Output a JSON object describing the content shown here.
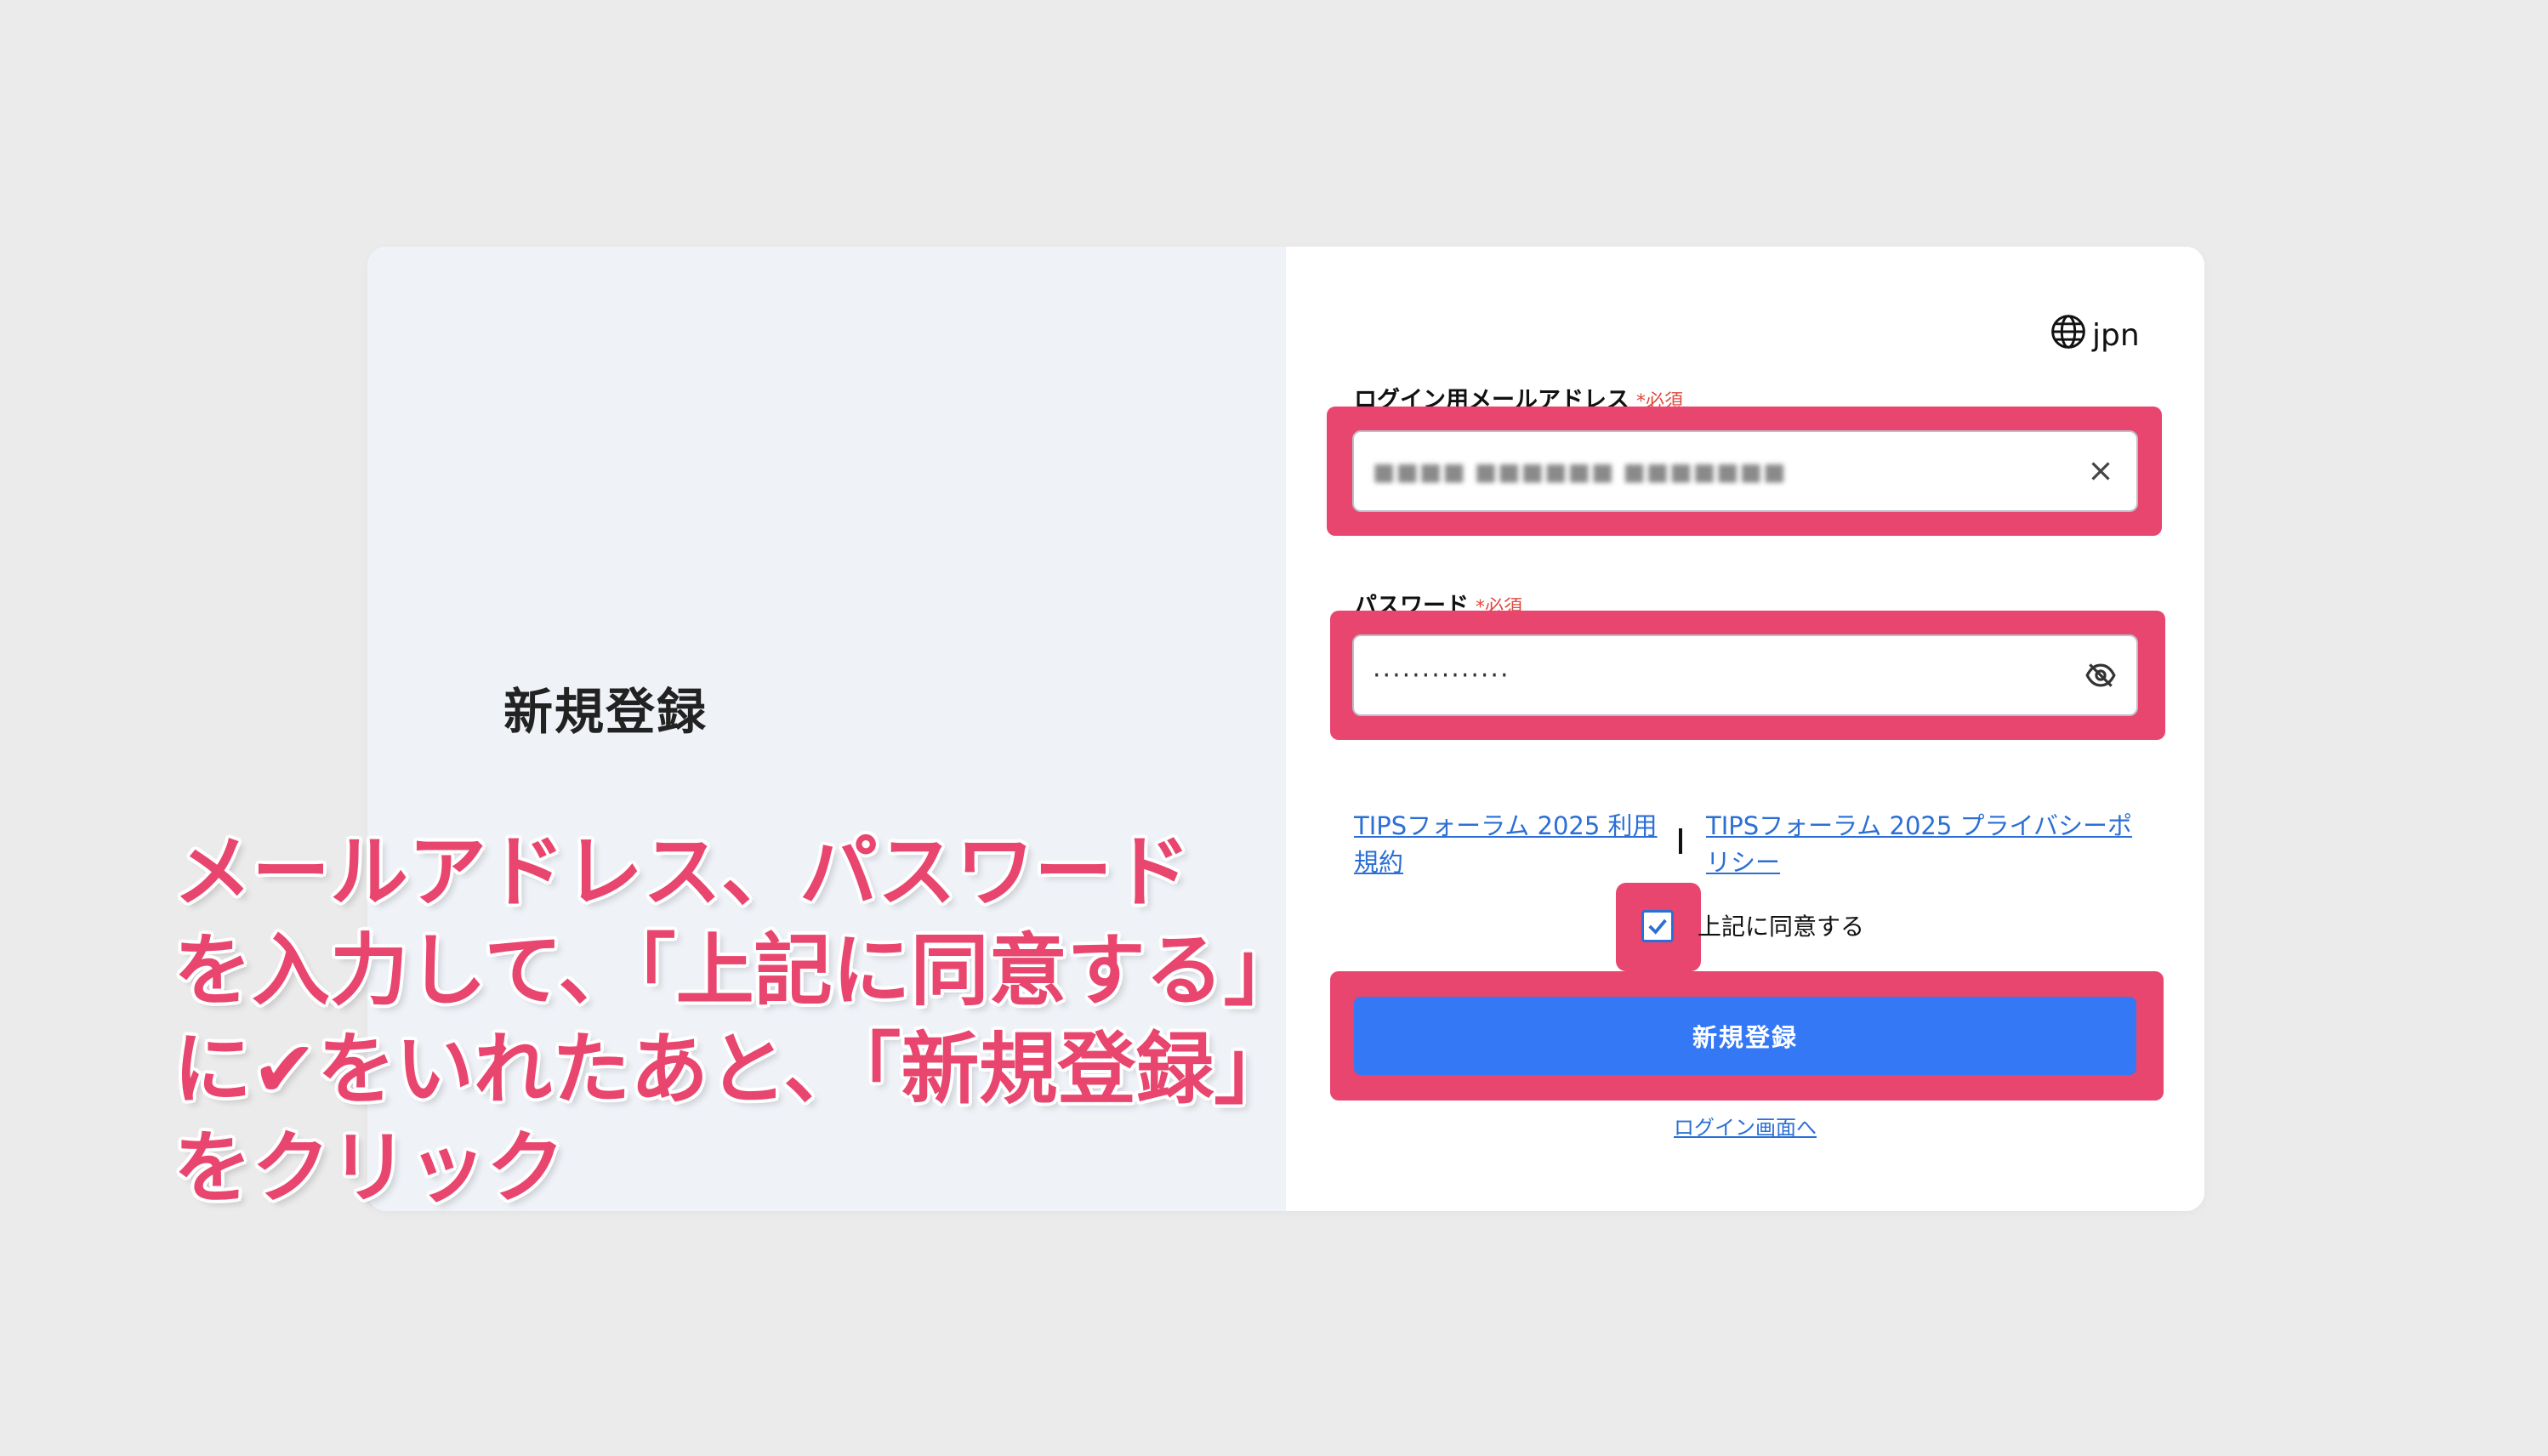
{
  "left_panel": {
    "title": "新規登録"
  },
  "language": {
    "label": "jpn",
    "icon": "globe-icon"
  },
  "email": {
    "label": "ログイン用メールアドレス",
    "required": "*必須",
    "value": "■■■■ ■■■■■■ ■■■■■■■",
    "clear_icon": "close-icon"
  },
  "password": {
    "label": "パスワード",
    "required": "*必須",
    "value": "··············",
    "toggle_icon": "eye-off-icon"
  },
  "terms": {
    "tos_link": "TIPSフォーラム 2025 利用規約",
    "privacy_link": "TIPSフォーラム 2025 プライバシーポリシー",
    "separator": "|"
  },
  "agree": {
    "checked": true,
    "label": "上記に同意する"
  },
  "submit": {
    "label": "新規登録"
  },
  "login_link": "ログイン画面へ",
  "annotation": {
    "lines": [
      "メールアドレス、パスワード",
      "を入力して、「上記に同意する」",
      "に✔をいれたあと、「新規登録」",
      "をクリック"
    ]
  },
  "colors": {
    "highlight": "#e8466e",
    "primary_button": "#3478f6",
    "link": "#2b6fd6",
    "required": "#e0493f"
  }
}
